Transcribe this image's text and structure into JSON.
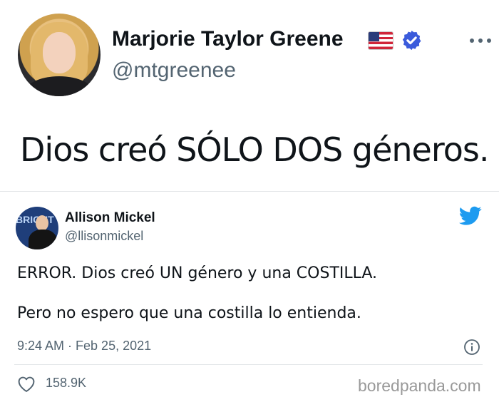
{
  "original_tweet": {
    "author_name": "Marjorie Taylor Greene",
    "handle": "@mtgreenee",
    "text": "Dios creó SÓLO DOS géneros.",
    "flag_icon": "us-flag-icon",
    "verified_icon": "verified-badge-icon",
    "more_icon": "more-options-icon"
  },
  "reply_tweet": {
    "author_name": "Allison Mickel",
    "handle": "@llisonmickel",
    "line1": "ERROR. Dios creó UN género y una COSTILLA.",
    "line2": "Pero no espero que una costilla lo entienda.",
    "timestamp": "9:24 AM · Feb 25, 2021",
    "like_count": "158.9K",
    "avatar_text": "BRIGHT",
    "platform_icon": "twitter-bird-icon",
    "info_icon": "info-icon",
    "like_icon": "heart-icon"
  },
  "watermark": "boredpanda.com",
  "colors": {
    "text_primary": "#0f1419",
    "text_secondary": "#536471",
    "twitter_blue": "#1d9bf0",
    "verified_blue": "#3b5bdb",
    "watermark_gray": "#999999"
  }
}
